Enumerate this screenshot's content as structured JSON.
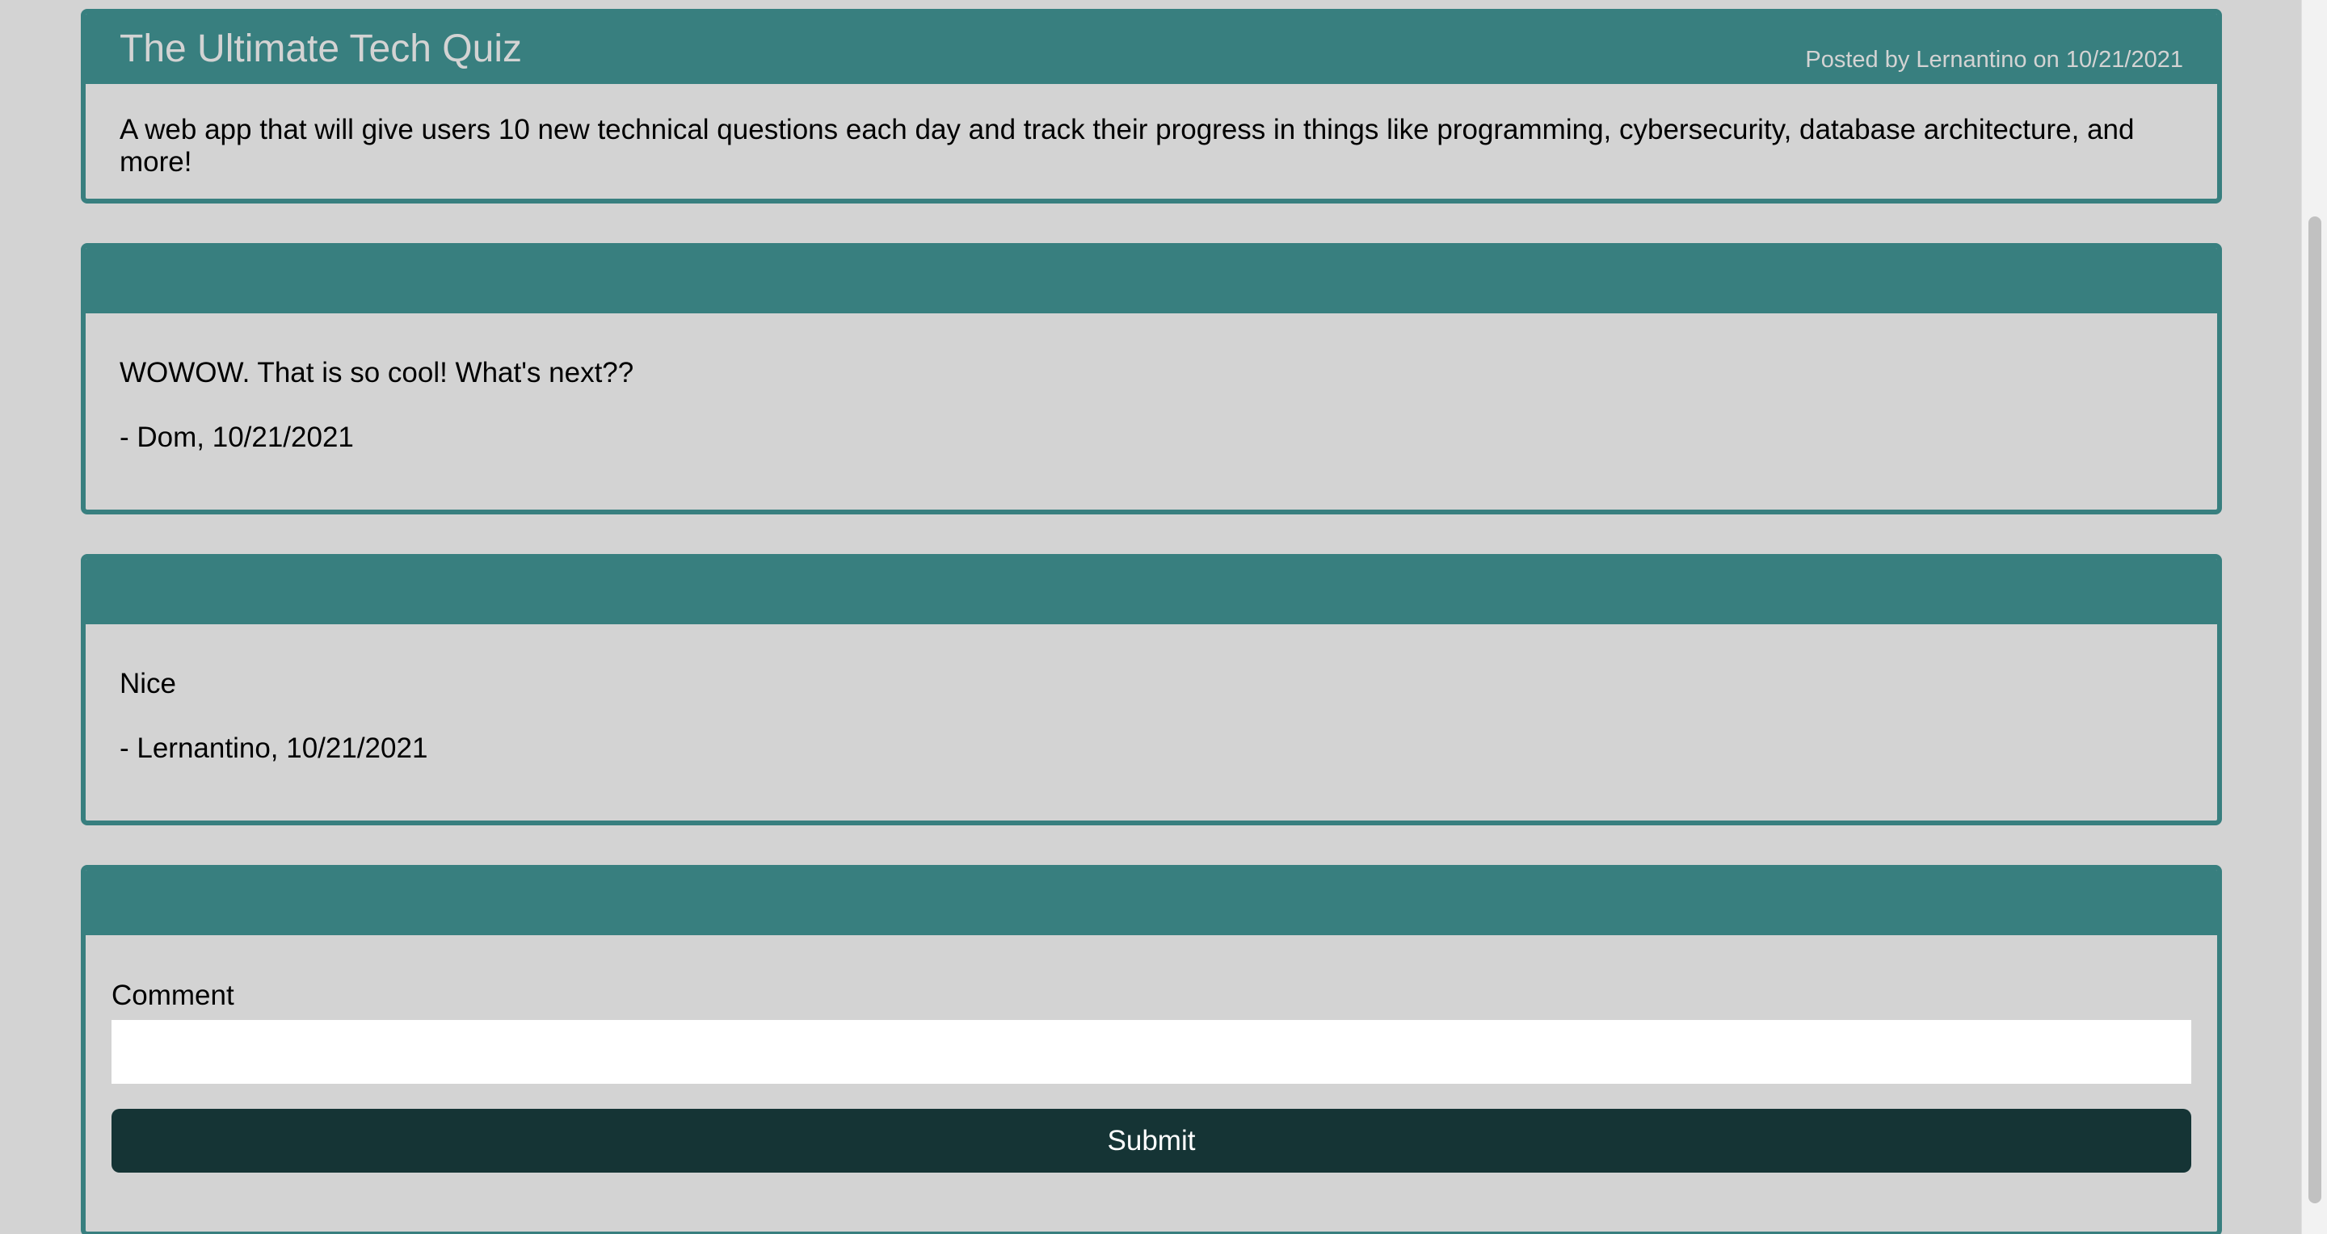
{
  "post": {
    "title": "The Ultimate Tech Quiz",
    "meta": "Posted by Lernantino on 10/21/2021",
    "body": "A web app that will give users 10 new technical questions each day and track their progress in things like programming, cybersecurity, database architecture, and more!"
  },
  "comments": [
    {
      "text": "WOWOW. That is so cool! What's next??",
      "attribution": "- Dom, 10/21/2021"
    },
    {
      "text": "Nice",
      "attribution": "- Lernantino, 10/21/2021"
    }
  ],
  "comment_form": {
    "label": "Comment",
    "input_value": "",
    "submit_label": "Submit"
  },
  "colors": {
    "background": "#d3d3d3",
    "card_accent": "#387f7f",
    "button_dark": "#153435",
    "input_bg": "#ffffff"
  }
}
